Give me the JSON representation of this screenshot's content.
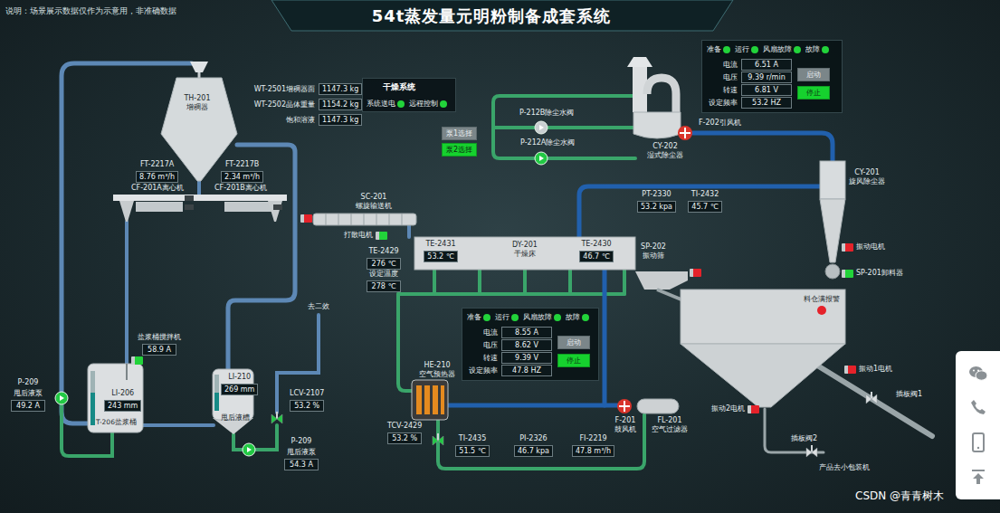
{
  "note": "说明：场景展示数据仅作为示意用，非准确数据",
  "title": "54t蒸发量元明粉制备成套系统",
  "equipment": [
    {
      "tag": "TH-201",
      "name": "增稠器"
    },
    {
      "tag": "SC-201",
      "name": "螺旋输送机"
    },
    {
      "tag": "DY-201",
      "name": "干燥床"
    },
    {
      "tag": "SP-202",
      "name": "振动筛"
    },
    {
      "tag": "CY-202",
      "name": "湿式除尘器"
    },
    {
      "tag": "CY-201",
      "name": "旋风除尘器"
    },
    {
      "tag": "HE-210",
      "name": "空气预热器"
    },
    {
      "tag": "F-201",
      "name": "鼓风机"
    },
    {
      "tag": "FL-201",
      "name": "空气过滤器"
    }
  ],
  "labels": [
    "CF-201A离心机",
    "CF-201B离心机",
    "P-212B除尘水阀",
    "P-212A除尘水阀",
    "F-202引风机",
    "去二效",
    "甩后液槽",
    "T-206盐浆桶",
    "产品去小包装机",
    "插板阀1",
    "插板阀2"
  ],
  "weights": [
    {
      "label": "WT-2501增稠器面",
      "value": "1147.3 kg"
    },
    {
      "label": "WT-2502晶体重量",
      "value": "1154.2 kg"
    },
    {
      "label": "饱和溶液",
      "value": "1147.3 kg"
    }
  ],
  "readouts": [
    {
      "label": "FT-2217A",
      "value": "8.76 m³/h"
    },
    {
      "label": "FT-2217B",
      "value": "2.34 m³/h"
    },
    {
      "label": "TE-2429",
      "value": "276 ℃"
    },
    {
      "label": "设定温度",
      "value": "278 ℃"
    },
    {
      "label": "TE-2431",
      "value": "53.2 ℃"
    },
    {
      "label": "TE-2430",
      "value": "46.7 ℃"
    },
    {
      "label": "PT-2330",
      "value": "53.2 kpa"
    },
    {
      "label": "TI-2432",
      "value": "45.7 ℃"
    },
    {
      "label": "盐浆桶搅拌机",
      "value": "58.9 A"
    },
    {
      "label": "LI-210",
      "value": "269 mm"
    },
    {
      "label": "LCV-2107",
      "value": "53.2 %"
    },
    {
      "label": "LI-206",
      "value": "243 mm"
    },
    {
      "label": "TCV-2429",
      "value": "53.2 %"
    },
    {
      "label": "TI-2435",
      "value": "51.5 ℃"
    },
    {
      "label": "PI-2326",
      "value": "46.7 kpa"
    },
    {
      "label": "FI-2219",
      "value": "47.8 m³/h"
    },
    {
      "label": "P-209",
      "sub": "甩后液泵",
      "value": "49.2 A"
    },
    {
      "label": "P-209",
      "sub": "甩后液泵",
      "value": "54.3 A"
    }
  ],
  "dry_system": {
    "title": "干燥系统",
    "indicators": [
      {
        "label": "系统送电",
        "on": true
      },
      {
        "label": "远程控制",
        "on": true
      }
    ]
  },
  "pump_select": [
    {
      "label": "泵1选择",
      "selected": false
    },
    {
      "label": "泵2选择",
      "selected": true
    }
  ],
  "drive_panels": [
    {
      "indicators": [
        {
          "label": "准备",
          "on": true
        },
        {
          "label": "运行",
          "on": true
        },
        {
          "label": "风扇故障",
          "on": true
        },
        {
          "label": "故障",
          "on": true
        }
      ],
      "rows": [
        {
          "label": "电流",
          "value": "6.51 A"
        },
        {
          "label": "电压",
          "value": "9.39 r/min"
        },
        {
          "label": "转速",
          "value": "6.81 V"
        },
        {
          "label": "设定频率",
          "value": "53.2 HZ"
        }
      ],
      "buttons": [
        {
          "label": "启动",
          "selected": false
        },
        {
          "label": "停止",
          "selected": true
        }
      ]
    },
    {
      "indicators": [
        {
          "label": "准备",
          "on": true
        },
        {
          "label": "运行",
          "on": true
        },
        {
          "label": "风扇故障",
          "on": true
        },
        {
          "label": "故障",
          "on": true
        }
      ],
      "rows": [
        {
          "label": "电流",
          "value": "8.55 A"
        },
        {
          "label": "电压",
          "value": "8.62 V"
        },
        {
          "label": "转速",
          "value": "9.39 V"
        },
        {
          "label": "设定频率",
          "value": "47.8 HZ"
        }
      ],
      "buttons": [
        {
          "label": "启动",
          "selected": false
        },
        {
          "label": "停止",
          "selected": true
        }
      ]
    }
  ],
  "motors": [
    {
      "label": "打散电机",
      "running": true
    },
    {
      "running": false
    },
    {
      "running": false
    },
    {
      "label": "振动电机",
      "running": false
    },
    {
      "label": "SP-201卸料器",
      "running": true
    },
    {
      "label": "振动1电机",
      "running": false
    },
    {
      "label": "振动2电机",
      "running": false
    },
    {
      "running": true
    }
  ],
  "pumps": [
    {
      "running": true
    },
    {
      "running": true
    },
    {
      "running": false
    },
    {
      "running": true
    }
  ],
  "valves": [
    {
      "open": true
    },
    {
      "open": true
    },
    {
      "open": false
    },
    {
      "open": false
    }
  ],
  "tanks": [
    {
      "level": 0.6
    },
    {
      "level": 0.5
    }
  ],
  "alarm": {
    "label": "料仓满报警",
    "active": true
  },
  "watermark": "CSDN @青青树木"
}
